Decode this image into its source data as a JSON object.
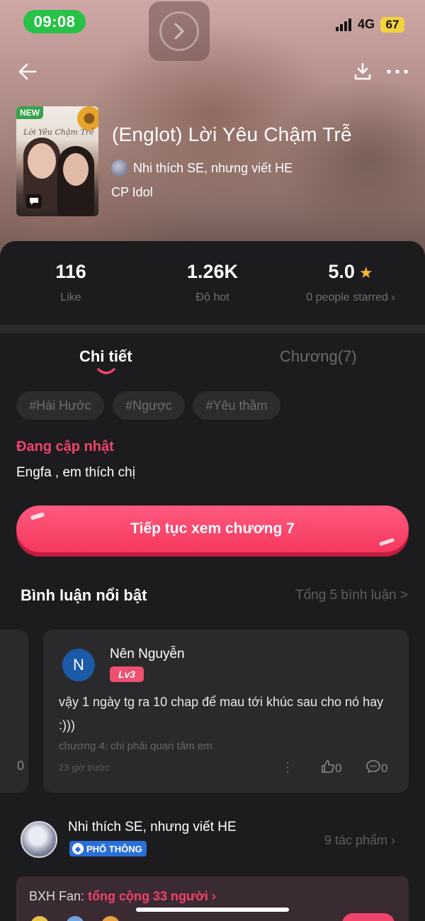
{
  "status_bar": {
    "time": "09:08",
    "network": "4G",
    "battery": "67"
  },
  "story": {
    "cover_badge": "NEW",
    "cover_text": "Lời Yêu Chậm Trễ",
    "title": "(Englot) Lời Yêu Chậm Trễ",
    "author": "Nhi thích SE, nhưng viết HE",
    "category": "CP Idol"
  },
  "stats": [
    {
      "value": "116",
      "label": "Like"
    },
    {
      "value": "1.26K",
      "label": "Độ hot"
    },
    {
      "value": "5.0",
      "label": "0 people starred ›"
    }
  ],
  "tabs": {
    "detail": "Chi tiết",
    "chapters": "Chương(7)",
    "active": "detail"
  },
  "tags": [
    "#Hài Hước",
    "#Ngược",
    "#Yêu thầm"
  ],
  "update_status": "Đang cập nhật",
  "description": "Engfa , em thích chị",
  "cta_label": "Tiếp tục xem chương 7",
  "comments_section": {
    "title": "Bình luận nổi bật",
    "total": "Tổng 5 bình luận >"
  },
  "prev_comment": {
    "count": "0"
  },
  "comment": {
    "avatar_letter": "N",
    "name": "Nên Nguyễn",
    "level": "Lv3",
    "text": "vậy 1 ngày tg ra 10 chap để mau tới khúc sau cho nó hay :)))",
    "chapter": "chương 4: chị phải quan tâm em",
    "time": "23 giờ trước",
    "likes": "0",
    "replies": "0"
  },
  "author_section": {
    "name": "Nhi thích SE, nhưng viết HE",
    "badge": "PHỔ THÔNG",
    "works": "9 tác phẩm ›"
  },
  "fan_board": {
    "label": "BXH Fan:",
    "total": "tổng cộng 33 người ›"
  },
  "colors": {
    "accent": "#f0446a",
    "background": "#1c1c1e",
    "card": "#2a2a2d",
    "status_green": "#27c247"
  }
}
